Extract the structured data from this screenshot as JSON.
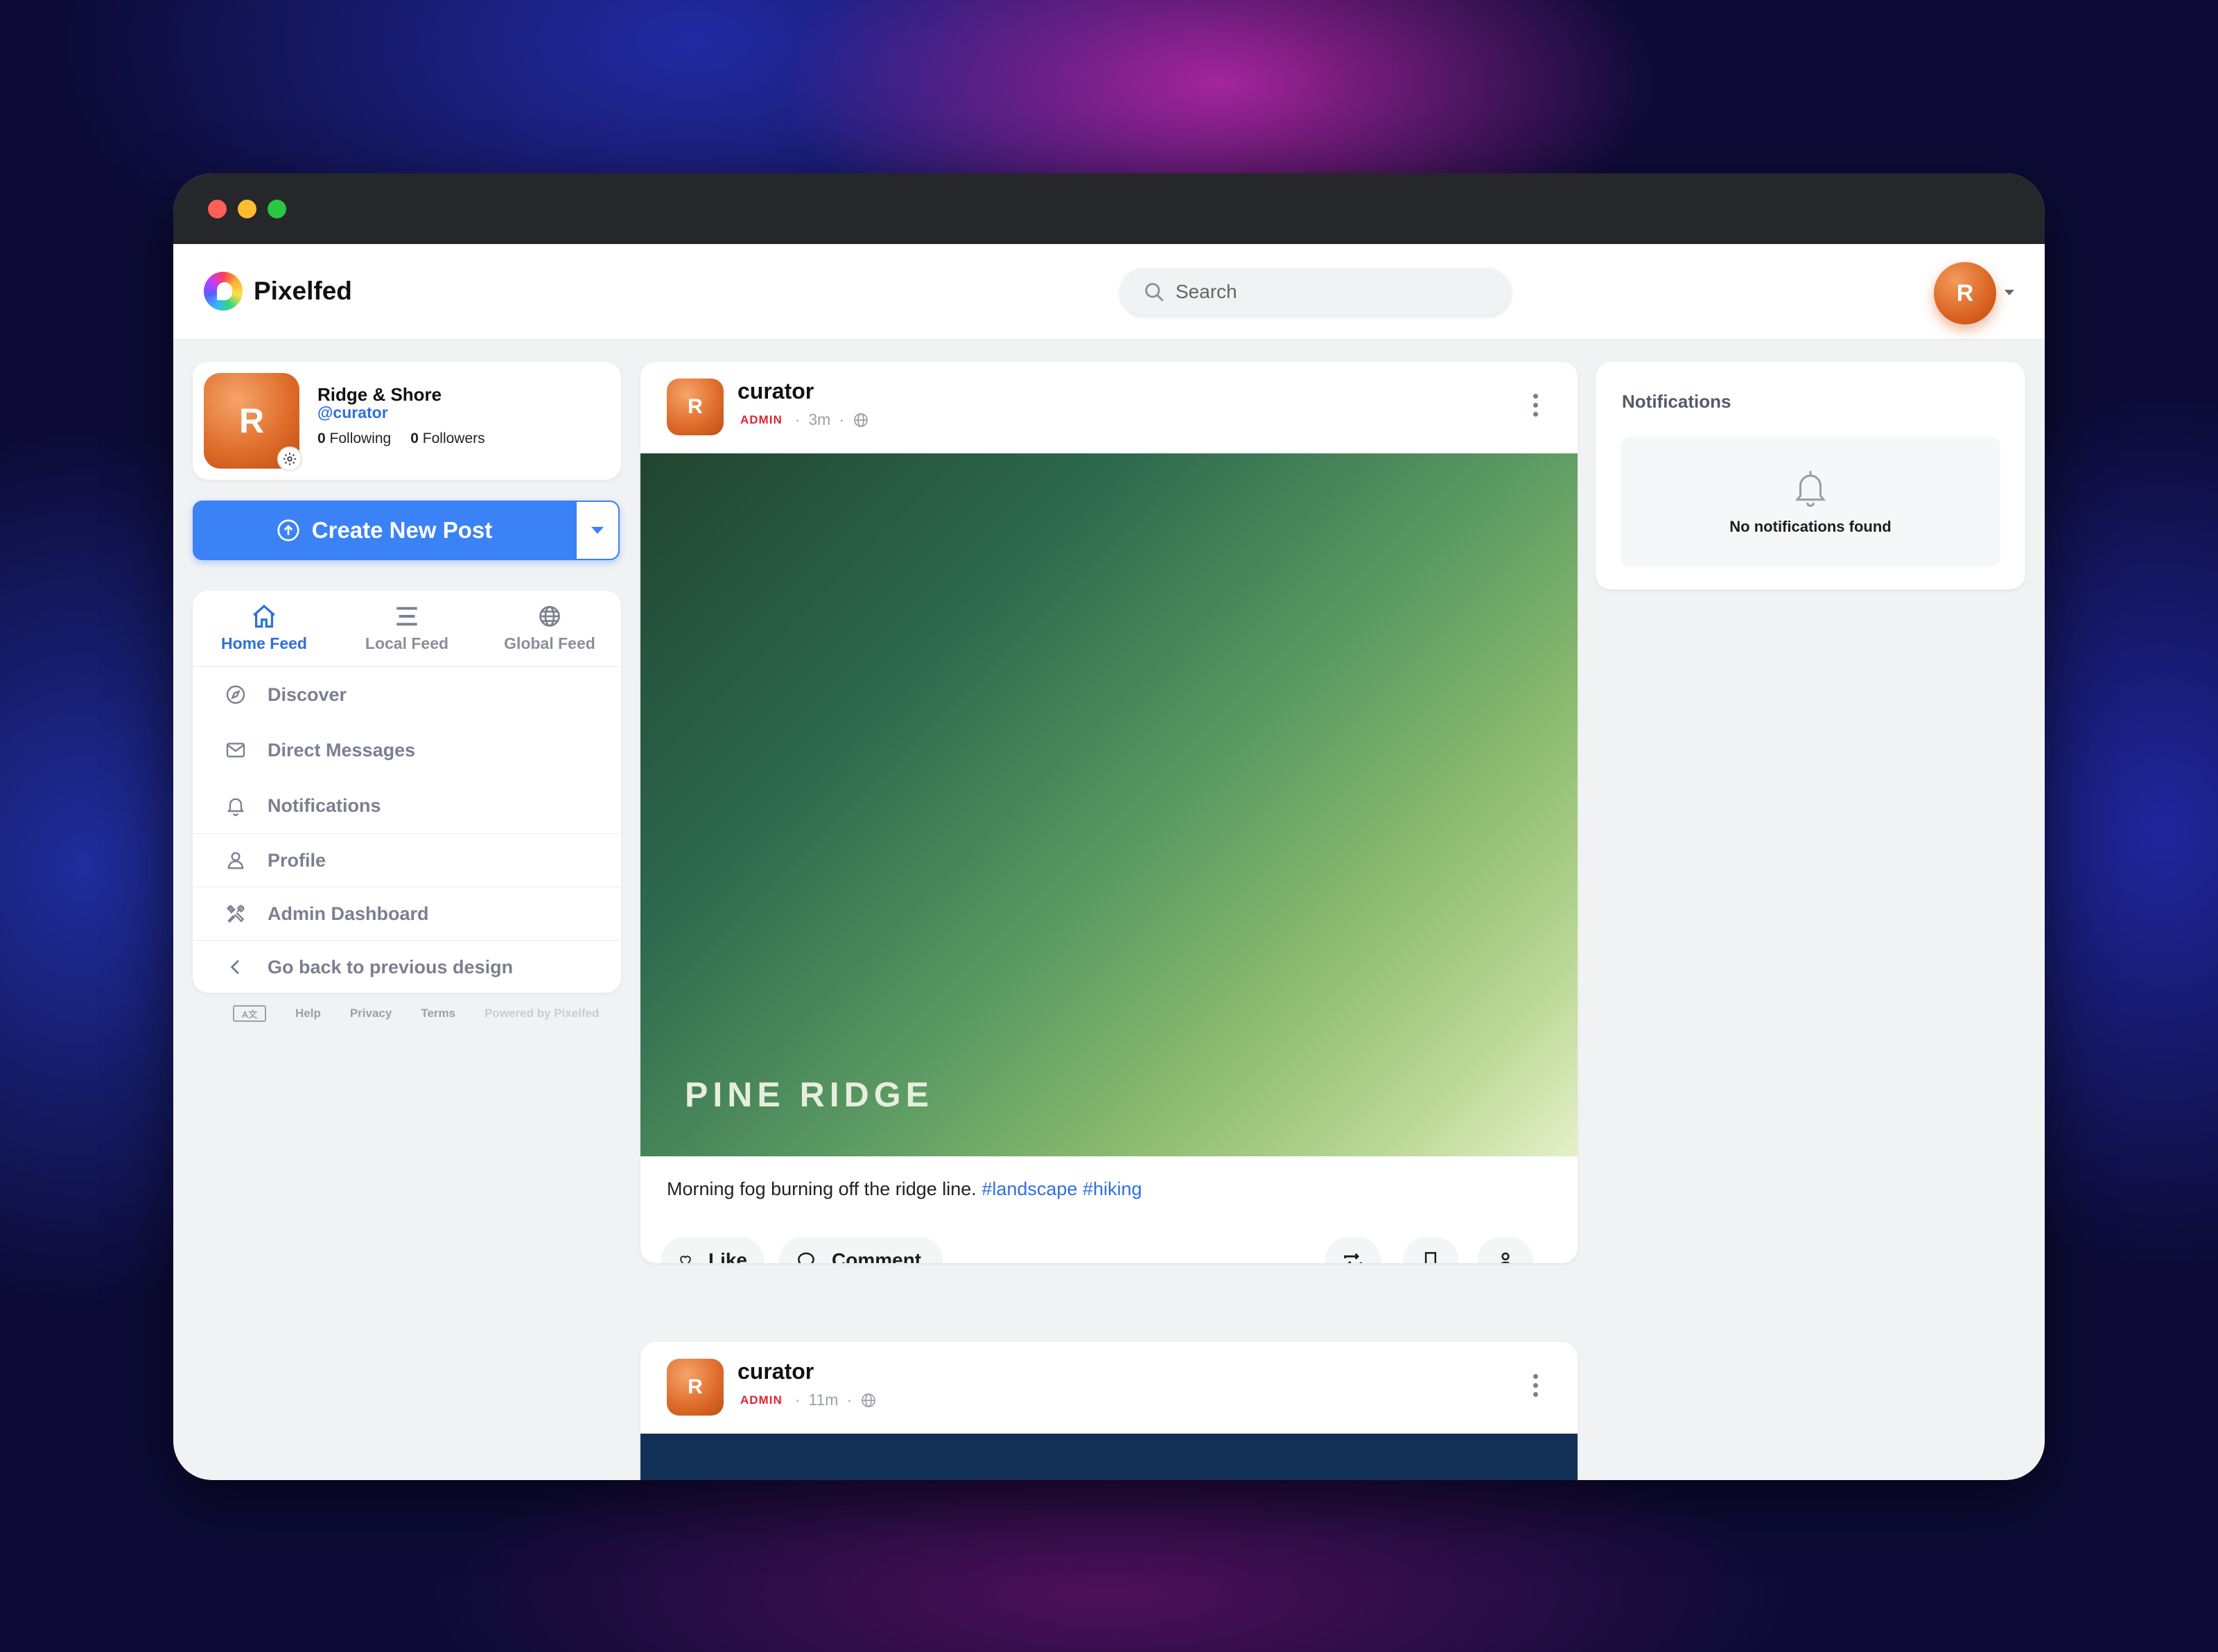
{
  "app": {
    "name": "Pixelfed"
  },
  "search": {
    "placeholder": "Search"
  },
  "user": {
    "avatar_letter": "R",
    "display_name": "Ridge & Shore",
    "handle": "@curator",
    "following_count": "0",
    "following_label": "Following",
    "followers_count": "0",
    "followers_label": "Followers"
  },
  "create_post": {
    "label": "Create New Post"
  },
  "feed_tabs": [
    {
      "label": "Home Feed",
      "icon": "home-icon",
      "active": true
    },
    {
      "label": "Local Feed",
      "icon": "list-icon",
      "active": false
    },
    {
      "label": "Global Feed",
      "icon": "globe-icon",
      "active": false
    }
  ],
  "nav": [
    {
      "label": "Discover",
      "icon": "compass-icon"
    },
    {
      "label": "Direct Messages",
      "icon": "mail-icon"
    },
    {
      "label": "Notifications",
      "icon": "bell-icon"
    },
    {
      "label": "Profile",
      "icon": "user-icon"
    },
    {
      "label": "Admin Dashboard",
      "icon": "tools-icon"
    },
    {
      "label": "Go back to previous design",
      "icon": "chevron-left-icon"
    }
  ],
  "footer": {
    "language_icon": "translate-icon",
    "help": "Help",
    "privacy": "Privacy",
    "terms": "Terms",
    "powered": "Powered by Pixelfed"
  },
  "posts": [
    {
      "avatar_letter": "R",
      "username": "curator",
      "badge": "ADMIN",
      "time": "3m",
      "visibility_icon": "globe-icon",
      "image_caption": "PINE RIDGE",
      "caption_text": "Morning fog burning off the ridge line.",
      "hashtags": [
        "#landscape",
        "#hiking"
      ],
      "like_label": "Like",
      "comment_label": "Comment"
    },
    {
      "avatar_letter": "R",
      "username": "curator",
      "badge": "ADMIN",
      "time": "11m",
      "visibility_icon": "globe-icon"
    }
  ],
  "notifications": {
    "title": "Notifications",
    "empty_text": "No notifications found"
  },
  "colors": {
    "accent": "#3b82f6",
    "admin_badge": "#e0242f",
    "hashtag": "#2f6fdf",
    "avatar": "#dd6a28"
  }
}
